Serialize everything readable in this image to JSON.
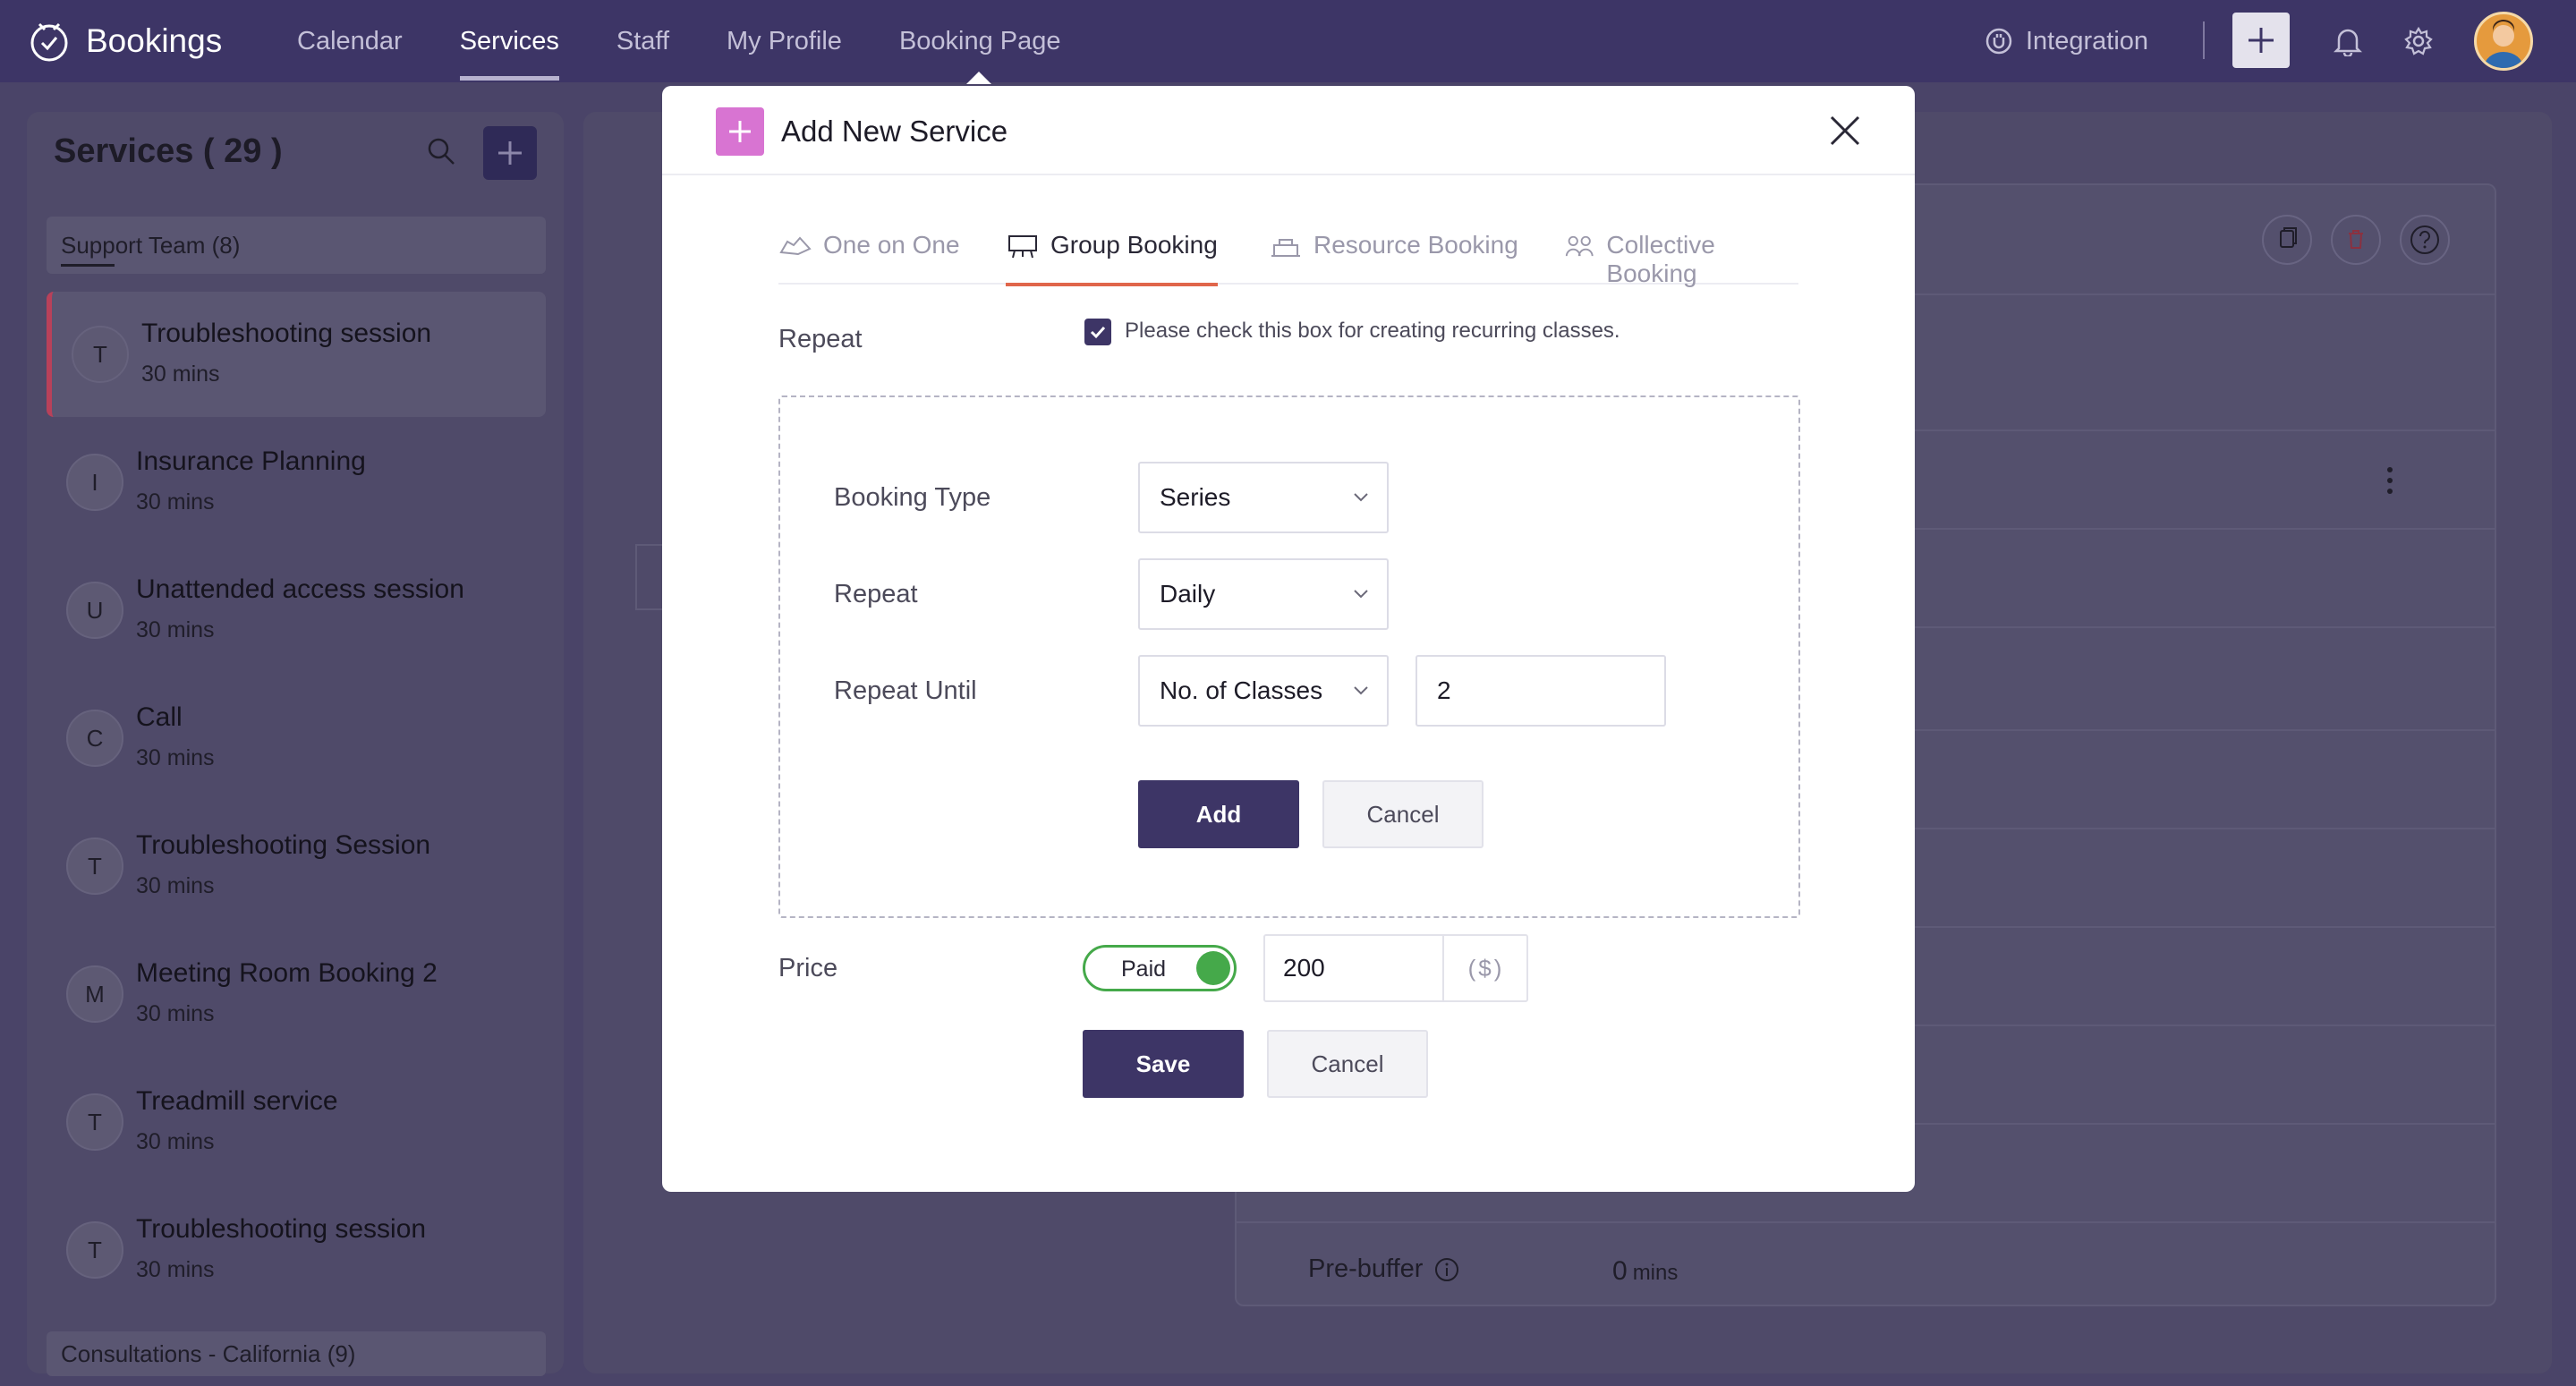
{
  "app": {
    "name": "Bookings",
    "nav": [
      "Calendar",
      "Services",
      "Staff",
      "My Profile",
      "Booking Page"
    ],
    "active_nav": "Services",
    "integration_label": "Integration"
  },
  "sidebar": {
    "title": "Services ( 29 )",
    "groups": [
      {
        "label": "Support Team (8)"
      },
      {
        "label": "Consultations - California (9)"
      }
    ],
    "services": [
      {
        "initial": "T",
        "name": "Troubleshooting session",
        "duration": "30 mins",
        "selected": true
      },
      {
        "initial": "I",
        "name": "Insurance Planning",
        "duration": "30 mins"
      },
      {
        "initial": "U",
        "name": "Unattended access session",
        "duration": "30 mins"
      },
      {
        "initial": "C",
        "name": "Call",
        "duration": "30 mins"
      },
      {
        "initial": "T",
        "name": "Troubleshooting Session",
        "duration": "30 mins"
      },
      {
        "initial": "M",
        "name": "Meeting Room Booking 2",
        "duration": "30 mins"
      },
      {
        "initial": "T",
        "name": "Treadmill service",
        "duration": "30 mins"
      },
      {
        "initial": "T",
        "name": "Troubleshooting session",
        "duration": "30 mins"
      }
    ]
  },
  "detail": {
    "prebuffer_label": "Pre-buffer",
    "prebuffer_value": "0",
    "prebuffer_unit": "mins"
  },
  "modal": {
    "title": "Add New Service",
    "tabs": [
      {
        "label": "One on One"
      },
      {
        "label": "Group Booking"
      },
      {
        "label": "Resource Booking"
      },
      {
        "label": "Collective Booking"
      }
    ],
    "active_tab": "Group Booking",
    "repeat_label": "Repeat",
    "repeat_checkbox_text": "Please check this box for creating recurring classes.",
    "repeat_checked": true,
    "recurrence": {
      "booking_type_label": "Booking Type",
      "booking_type_value": "Series",
      "repeat_label": "Repeat",
      "repeat_value": "Daily",
      "repeat_until_label": "Repeat Until",
      "repeat_until_value": "No. of Classes",
      "classes_count": "2",
      "add_label": "Add",
      "cancel_label": "Cancel"
    },
    "price": {
      "label": "Price",
      "toggle_label": "Paid",
      "value": "200",
      "currency": "($)"
    },
    "save_label": "Save",
    "cancel_label": "Cancel"
  },
  "colors": {
    "topbar": "#3d3566",
    "primary_button": "#3d3566",
    "active_tab_underline": "#e0664b",
    "toggle_on": "#45a94a",
    "modal_plus": "#d874d2"
  }
}
